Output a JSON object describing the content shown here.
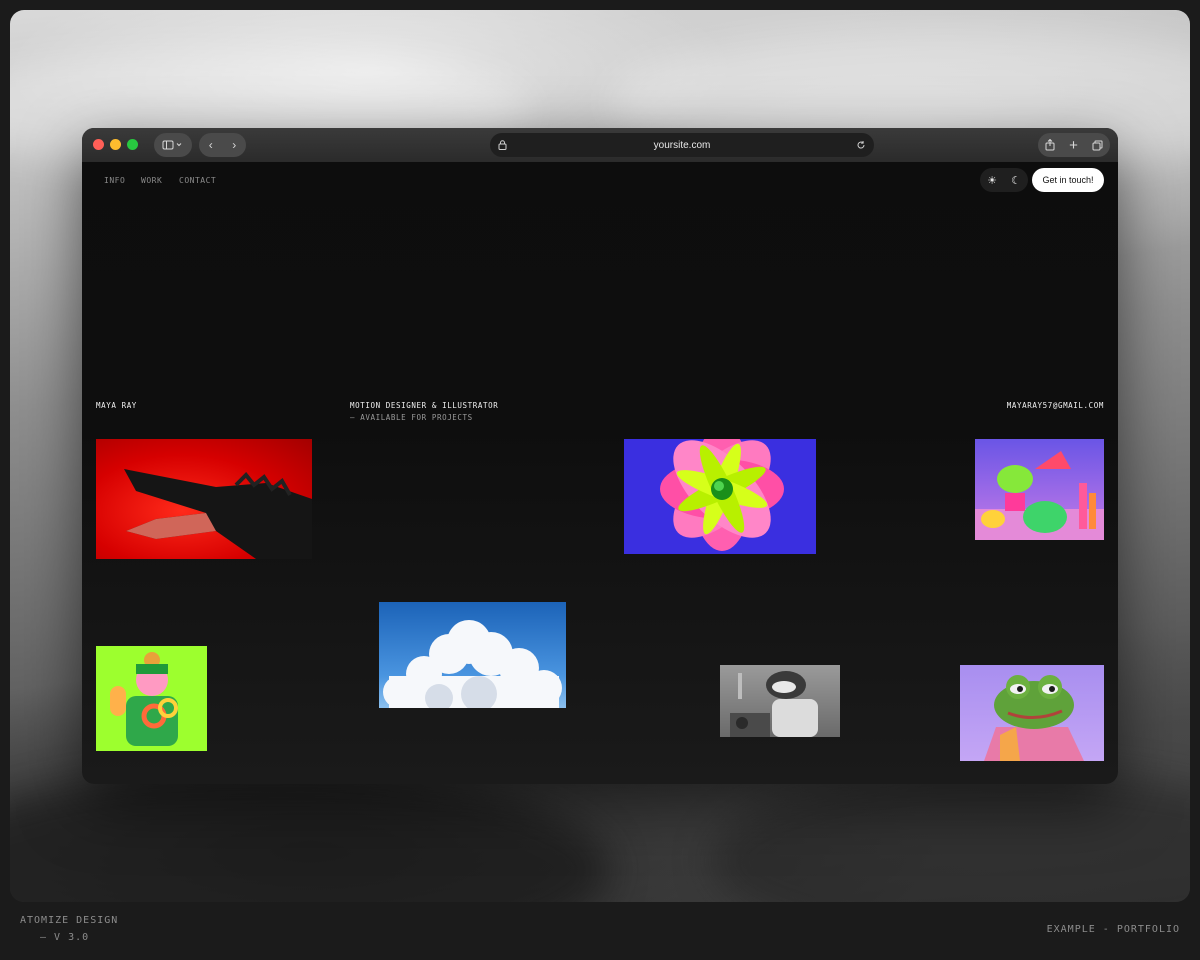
{
  "browser": {
    "url": "yoursite.com"
  },
  "nav": {
    "items": [
      "INFO",
      "WORK",
      "CONTACT"
    ],
    "cta_label": "Get in touch!"
  },
  "hero": {
    "name": "MAYA RAY",
    "role": "MOTION DESIGNER & ILLUSTRATOR",
    "availability": "— AVAILABLE FOR PROJECTS",
    "email": "MAYARAY57@GMAIL.COM"
  },
  "footer": {
    "brand": "ATOMIZE DESIGN",
    "version": "— V 3.0",
    "label": "EXAMPLE - PORTFOLIO"
  },
  "colors": {
    "page_bg": "#1b1b1b",
    "site_bg": "#0d0d0d",
    "traffic_red": "#ff5f57",
    "traffic_yellow": "#febc2e",
    "traffic_green": "#28c840"
  }
}
